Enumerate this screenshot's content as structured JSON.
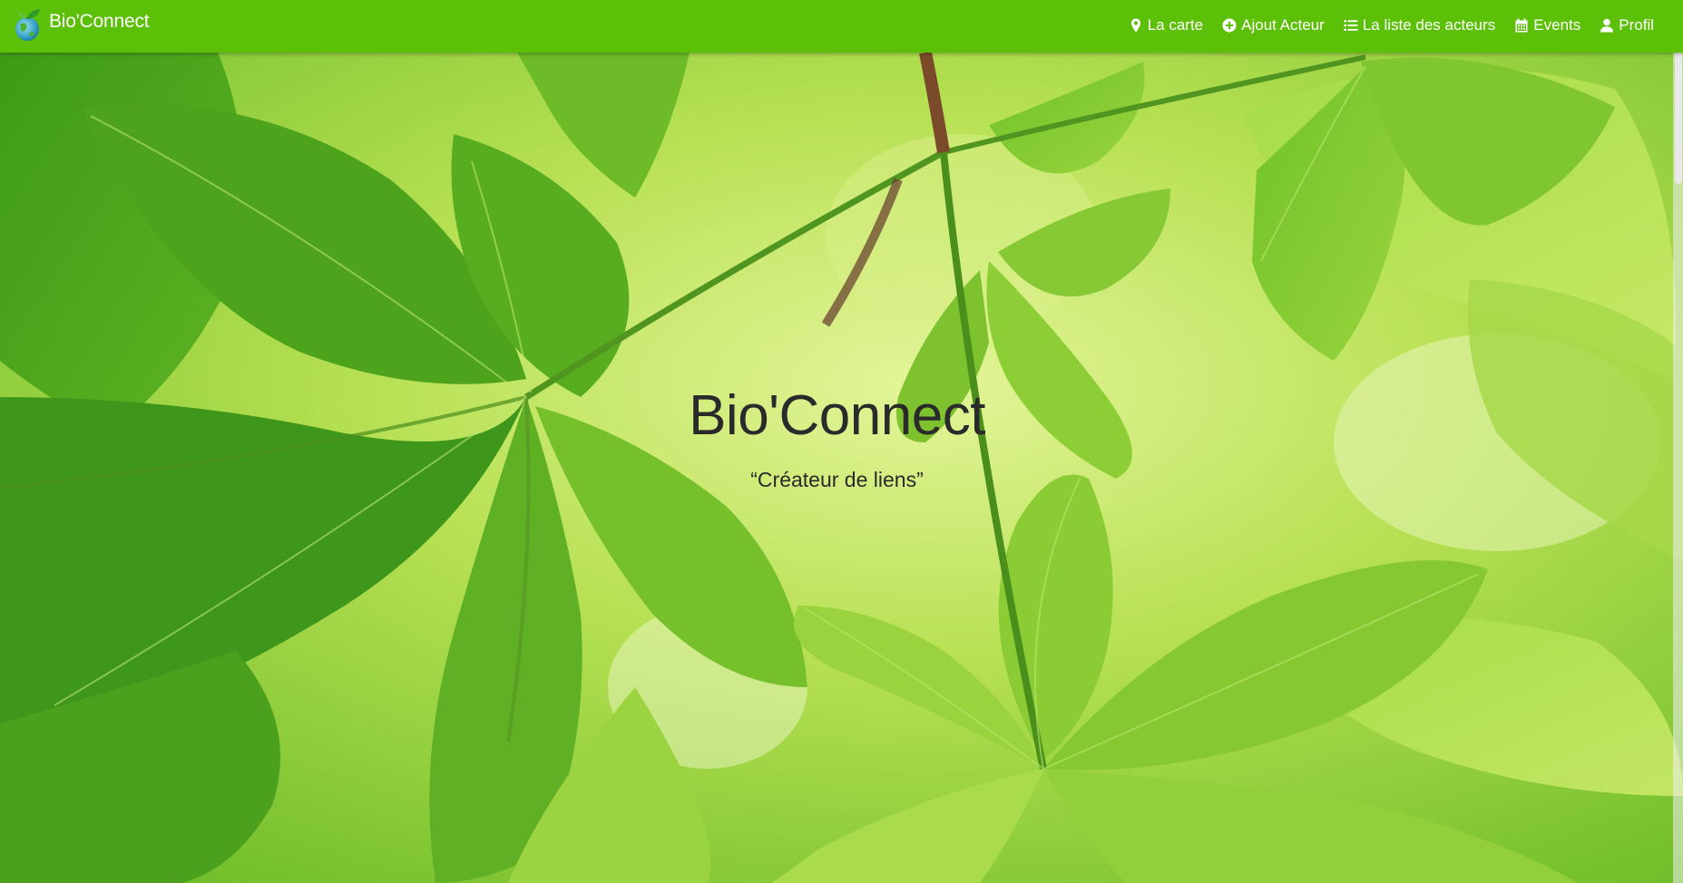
{
  "brand": {
    "name": "Bio'Connect",
    "logo_icon": "globe-leaf-logo-icon"
  },
  "nav": {
    "items": [
      {
        "label": "La carte",
        "icon": "map-marker-icon"
      },
      {
        "label": "Ajout Acteur",
        "icon": "plus-circle-icon"
      },
      {
        "label": "La liste des acteurs",
        "icon": "list-icon"
      },
      {
        "label": "Events",
        "icon": "calendar-icon"
      },
      {
        "label": "Profil",
        "icon": "user-icon"
      }
    ]
  },
  "hero": {
    "title": "Bio'Connect",
    "subtitle": "“Créateur de liens”"
  },
  "colors": {
    "navbar": "#5cbf08",
    "nav_text": "#ffffff",
    "hero_text": "#2a2a2a",
    "leaf_dark": "#3f9a14",
    "leaf_light": "#c8e860"
  }
}
